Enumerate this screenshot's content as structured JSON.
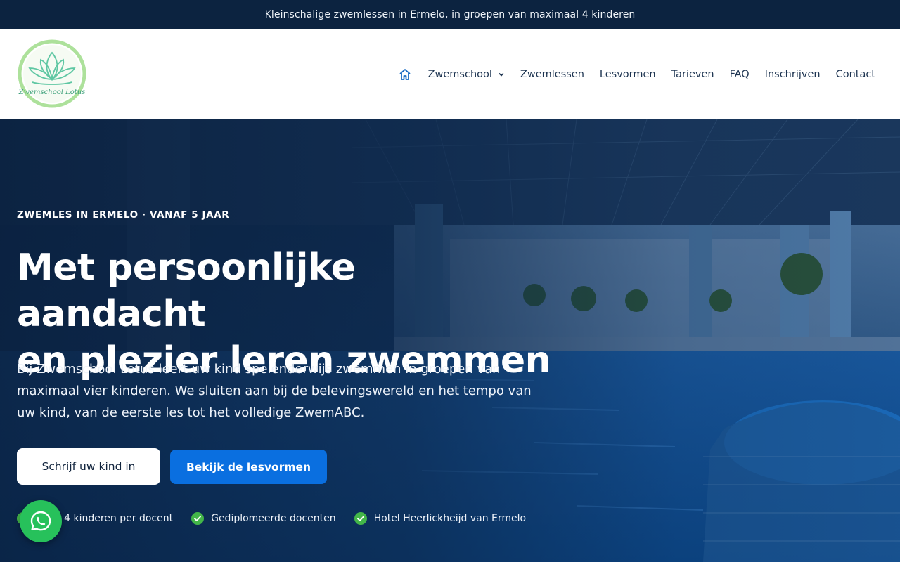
{
  "topbar": {
    "text": "Kleinschalige zwemlessen in Ermelo, in groepen van maximaal 4 kinderen"
  },
  "logo": {
    "text": "Zwemschool Lotus"
  },
  "nav": {
    "home_icon": "home-icon",
    "items": [
      {
        "label": "Zwemschool",
        "has_dropdown": true
      },
      {
        "label": "Zwemlessen"
      },
      {
        "label": "Lesvormen"
      },
      {
        "label": "Tarieven"
      },
      {
        "label": "FAQ"
      },
      {
        "label": "Inschrijven"
      },
      {
        "label": "Contact"
      }
    ]
  },
  "hero": {
    "eyebrow": "ZWEMLES IN ERMELO · VANAF 5 JAAR",
    "title_line1": "Met persoonlijke aandacht",
    "title_line2": "en plezier leren zwemmen",
    "intro": "Bij Zwemschool Lotus leert uw kind spelenderwijs zwemmen in groepen van maximaal vier kinderen. We sluiten aan bij de belevingswereld en het tempo van uw kind, van de eerste les tot het volledige ZwemABC.",
    "primary_button": "Schrijf uw kind in",
    "secondary_button": "Bekijk de lesvormen",
    "features": [
      "maal 4 kinderen per docent",
      "Gediplomeerde docenten",
      "Hotel Heerlickheijd van Ermelo"
    ]
  },
  "colors": {
    "topbar_bg": "#0c2340",
    "nav_text": "#1c3350",
    "accent_blue": "#0a6fe0",
    "check_green": "#43b649",
    "whatsapp_green": "#27c15b"
  },
  "icons": {
    "check": "check-circle-icon",
    "whatsapp": "whatsapp-icon",
    "chevron": "chevron-down-icon"
  }
}
